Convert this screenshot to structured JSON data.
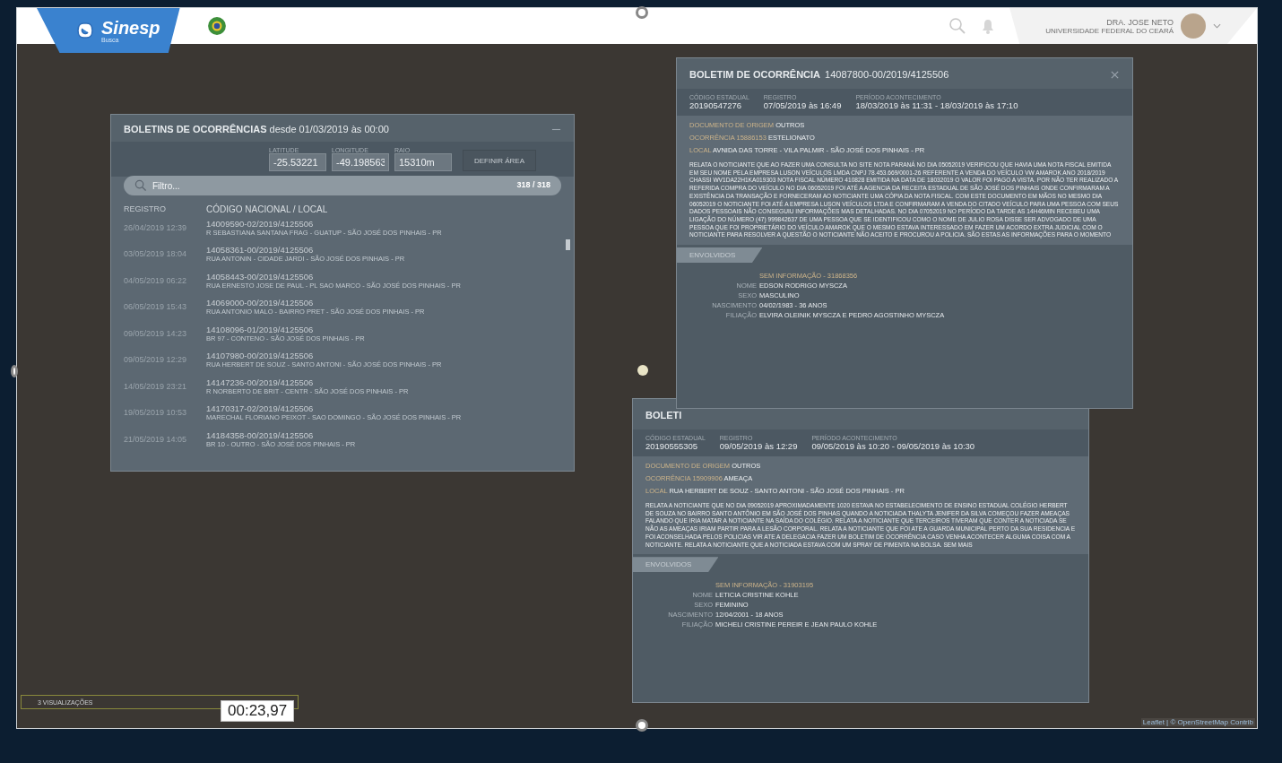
{
  "header": {
    "logo": "Sinesp",
    "logo_sub": "Busca",
    "user_name": "DRA. JOSE NETO",
    "user_org": "UNIVERSIDADE FEDERAL DO CEARÁ"
  },
  "list_panel": {
    "title": "BOLETINS DE OCORRÊNCIAS",
    "subtitle": "desde 01/03/2019 às 00:00",
    "fields": [
      {
        "label": "LATITUDE",
        "value": "-25.53221"
      },
      {
        "label": "LONGITUDE",
        "value": "-49.198563"
      },
      {
        "label": "RAIO",
        "value": "15310m"
      }
    ],
    "define_button": "DEFINIR ÁREA",
    "filter_placeholder": "Filtro...",
    "count": "318 / 318",
    "columns": [
      "REGISTRO",
      "CÓDIGO NACIONAL / LOCAL"
    ],
    "rows": [
      {
        "date": "26/04/2019 12:39",
        "code": "14009590-02/2019/4125506",
        "place": "R SEBASTIANA SANTANA FRAG - GUATUP - SÃO JOSÉ DOS PINHAIS - PR"
      },
      {
        "date": "03/05/2019 18:04",
        "code": "14058361-00/2019/4125506",
        "place": "RUA ANTONIN - CIDADE JARDI - SÃO JOSÉ DOS PINHAIS - PR"
      },
      {
        "date": "04/05/2019 06:22",
        "code": "14058443-00/2019/4125506",
        "place": "RUA ERNESTO JOSE DE PAUL - PL SAO MARCO - SÃO JOSÉ DOS PINHAIS - PR"
      },
      {
        "date": "06/05/2019 15:43",
        "code": "14069000-00/2019/4125506",
        "place": "RUA ANTONIO MALO - BAIRRO PRET - SÃO JOSÉ DOS PINHAIS - PR"
      },
      {
        "date": "09/05/2019 14:23",
        "code": "14108096-01/2019/4125506",
        "place": "BR 97 - CONTENO - SÃO JOSÉ DOS PINHAIS - PR"
      },
      {
        "date": "09/05/2019 12:29",
        "code": "14107980-00/2019/4125506",
        "place": "RUA HERBERT DE SOUZ - SANTO ANTONI - SÃO JOSÉ DOS PINHAIS - PR"
      },
      {
        "date": "14/05/2019 23:21",
        "code": "14147236-00/2019/4125506",
        "place": "R NORBERTO DE BRIT - CENTR - SÃO JOSÉ DOS PINHAIS - PR"
      },
      {
        "date": "19/05/2019 10:53",
        "code": "14170317-02/2019/4125506",
        "place": "MARECHAL FLORIANO PEIXOT - SAO DOMINGO - SÃO JOSÉ DOS PINHAIS - PR"
      },
      {
        "date": "21/05/2019 14:05",
        "code": "14184358-00/2019/4125506",
        "place": "BR 10 - OUTRO - SÃO JOSÉ DOS PINHAIS - PR"
      }
    ]
  },
  "details": [
    {
      "title": "BOLETIM DE OCORRÊNCIA",
      "number": "14087800-00/2019/4125506",
      "meta": [
        {
          "label": "CÓDIGO ESTADUAL",
          "value": "20190547276"
        },
        {
          "label": "REGISTRO",
          "value": "07/05/2019 às 16:49"
        },
        {
          "label": "PERÍODO ACONTECIMENTO",
          "value": "18/03/2019 às 11:31 - 18/03/2019 às 17:10"
        }
      ],
      "facts": [
        {
          "label": "DOCUMENTO DE ORIGEM",
          "value": "OUTROS"
        },
        {
          "label": "OCORRÊNCIA 15886153",
          "value": "ESTELIONATO"
        },
        {
          "label": "LOCAL",
          "value": "AVNIDA DAS TORRE - VILA PALMIR - SÃO JOSÉ DOS PINHAIS - PR"
        }
      ],
      "report": "RELATA O NOTICIANTE QUE AO FAZER UMA CONSULTA NO SITE NOTA PARANÁ NO DIA 05052019 VERIFICOU QUE HAVIA UMA NOTA FISCAL EMITIDA EM SEU NOME PELA EMPRESA LUSON VEÍCULOS LMDA CNPJ 78.453.669/0001-26 REFERENTE A VENDA DO VEÍCULO VW AMAROK ANO 2018/2019 CHASSI WV1DA22H1KA019303 NOTA FISCAL NÚMERO 410828 EMITIDA NA DATA DE 18032019 O VALOR FOI PAGO A VISTA. POR NÃO TER REALIZADO A REFERIDA COMPRA DO VEÍCULO NO DIA 06052019 FOI ATÉ A AGENCIA DA RECEITA ESTADUAL DE SÃO JOSÉ DOS PINHAIS ONDE CONFIRMARAM A EXISTÊNCIA DA TRANSAÇÃO E FORNECERAM AO NOTICIANTE UMA CÓPIA DA NOTA FISCAL. COM ESTE DOCUMENTO EM MÃOS NO MESMO DIA 06052019 O NOTICIANTE FOI ATÉ A EMPRESA LUSON VEÍCULOS LTDA E CONFIRMARAM A VENDA DO CITADO VEÍCULO PARA UMA PESSOA COM SEUS DADOS PESSOAIS NÃO CONSEGUIU INFORMAÇÕES MAS DETALHADAS. NO DIA 07052019 NO PERÍODO DA TARDE AS 14H46MIN RECEBEU UMA LIGAÇÃO DO NÚMERO (47) 999842637 DE UMA PESSOA QUE SE IDENTIFICOU COMO O NOME DE JULIO ROSA DISSE SER ADVOGADO DE UMA PESSOA QUE FOI PROPRIETÁRIO DO VEÍCULO AMAROK QUE O MESMO ESTAVA INTERESSADO EM FAZER UM ACORDO EXTRA JUDICIAL COM O NOTICIANTE PARA RESOLVER A QUESTÃO O NOTICIANTE NÃO ACEITO E PROCUROU A POLICIA. SÃO ESTAS AS INFORMAÇÕES PARA O MOMENTO",
      "section": "ENVOLVIDOS",
      "person": {
        "heading": "SEM INFORMAÇÃO - 31868356",
        "fields": [
          {
            "label": "NOME",
            "value": "EDSON RODRIGO MYSCZA"
          },
          {
            "label": "SEXO",
            "value": "MASCULINO"
          },
          {
            "label": "NASCIMENTO",
            "value": "04/02/1983 - 36 ANOS"
          },
          {
            "label": "FILIAÇÃO",
            "value": "ELVIRA OLEINIK MYSCZA E PEDRO AGOSTINHO MYSCZA"
          }
        ]
      }
    },
    {
      "title": "BOLETI",
      "meta": [
        {
          "label": "CÓDIGO ESTADUAL",
          "value": "20190555305"
        },
        {
          "label": "REGISTRO",
          "value": "09/05/2019 às 12:29"
        },
        {
          "label": "PERÍODO ACONTECIMENTO",
          "value": "09/05/2019 às 10:20 - 09/05/2019 às 10:30"
        }
      ],
      "facts": [
        {
          "label": "DOCUMENTO DE ORIGEM",
          "value": "OUTROS"
        },
        {
          "label": "OCORRÊNCIA 15909906",
          "value": "AMEAÇA"
        },
        {
          "label": "LOCAL",
          "value": "RUA HERBERT DE SOUZ - SANTO ANTONI - SÃO JOSÉ DOS PINHAIS - PR"
        }
      ],
      "report": "RELATA A NOTICIANTE QUE NO DIA 09052019 APROXIMADAMENTE 1020 ESTAVA NO ESTABELECIMENTO DE ENSINO ESTADUAL COLÉGIO HERBERT DE SOUZA NO BAIRRO SANTO ANTÔNIO EM SÃO JOSÉ DOS PINHAS QUANDO A NOTICIADA THALYTA JENIFER DA SILVA COMEÇOU FAZER AMEAÇAS FALANDO QUE IRIA MATAR A NOTICIANTE NA SAÍDA DO COLÉGIO. RELATA A NOTICIANTE QUE TERCEIROS TIVERAM QUE CONTER A NOTICIADA SE NÃO AS AMEAÇAS IRIAM PARTIR PARA A LESÃO CORPORAL. RELATA A NOTICIANTE QUE FOI ATE A GUARDA MUNICIPAL PERTO DA SUA RESIDENCIA E FOI ACONSELHADA PELOS POLICIAS VIR ATE A DELEGACIA FAZER UM BOLETIM DE OCORRÊNCIA CASO VENHA ACONTECER ALGUMA COISA COM A NOTICIANTE. RELATA A NOTICIANTE QUE A NOTICIADA ESTAVA COM UM SPRAY DE PIMENTA NA BOLSA. SEM MAIS",
      "section": "ENVOLVIDOS",
      "person": {
        "heading": "SEM INFORMAÇÃO - 31903195",
        "fields": [
          {
            "label": "NOME",
            "value": "LETICIA CRISTINE KOHLE"
          },
          {
            "label": "SEXO",
            "value": "FEMININO"
          },
          {
            "label": "NASCIMENTO",
            "value": "12/04/2001 - 18 ANOS"
          },
          {
            "label": "FILIAÇÃO",
            "value": "MICHELI CRISTINE PEREIR E JEAN PAULO KOHLE"
          }
        ]
      }
    }
  ],
  "views": "3 VISUALIZAÇÕES",
  "timestamp": "00:23,97",
  "attribution": "Leaflet | © OpenStreetMap Contrib"
}
